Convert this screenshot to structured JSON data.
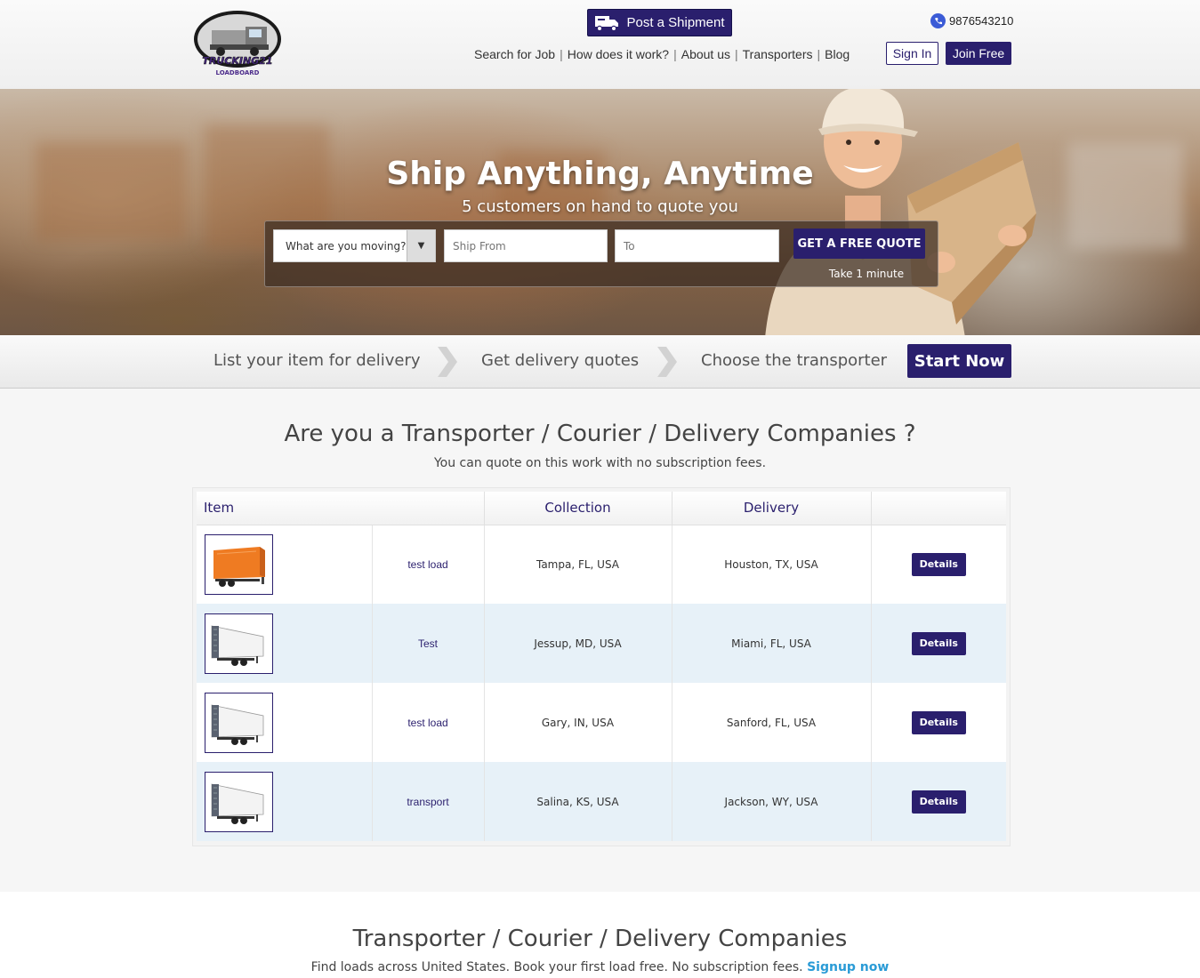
{
  "header": {
    "logo_text": "TRUCKING21",
    "logo_subtext": "LOADBOARD",
    "post_shipment_label": "Post a Shipment",
    "phone": "9876543210",
    "nav": [
      "Search for Job",
      "How does it work?",
      "About us",
      "Transporters",
      "Blog"
    ],
    "signin_label": "Sign In",
    "joinfree_label": "Join Free"
  },
  "hero": {
    "title": "Ship Anything, Anytime",
    "subtitle": "5 customers on hand to quote you",
    "select_placeholder": "What are you moving?",
    "ship_from_placeholder": "Ship From",
    "to_placeholder": "To",
    "quote_button": "GET A FREE QUOTE",
    "take_note": "Take 1 minute"
  },
  "steps": {
    "items": [
      "List your item for delivery",
      "Get delivery quotes",
      "Choose the transporter"
    ],
    "start_label": "Start Now"
  },
  "transporter_section": {
    "title": "Are you a Transporter / Courier / Delivery Companies ?",
    "subtitle": "You can quote on this work with no subscription fees.",
    "columns": [
      "Item",
      "Collection",
      "Delivery",
      ""
    ],
    "rows": [
      {
        "item": "test load",
        "collection": "Tampa, FL, USA",
        "delivery": "Houston, TX, USA",
        "action": "Details",
        "thumb": "orange-trailer"
      },
      {
        "item": "Test",
        "collection": "Jessup, MD, USA",
        "delivery": "Miami, FL, USA",
        "action": "Details",
        "thumb": "white-trailer"
      },
      {
        "item": "test load",
        "collection": "Gary, IN, USA",
        "delivery": "Sanford, FL, USA",
        "action": "Details",
        "thumb": "white-trailer"
      },
      {
        "item": "transport",
        "collection": "Salina, KS, USA",
        "delivery": "Jackson, WY, USA",
        "action": "Details",
        "thumb": "white-trailer"
      }
    ]
  },
  "bottom": {
    "title": "Transporter / Courier / Delivery Companies",
    "subtitle": "Find loads across United States. Book your first load free. No subscription fees.",
    "signup_label": "Signup now"
  },
  "colors": {
    "brand": "#2a1f6d",
    "link": "#2a9bd6",
    "row_alt": "#e7f1f8"
  }
}
